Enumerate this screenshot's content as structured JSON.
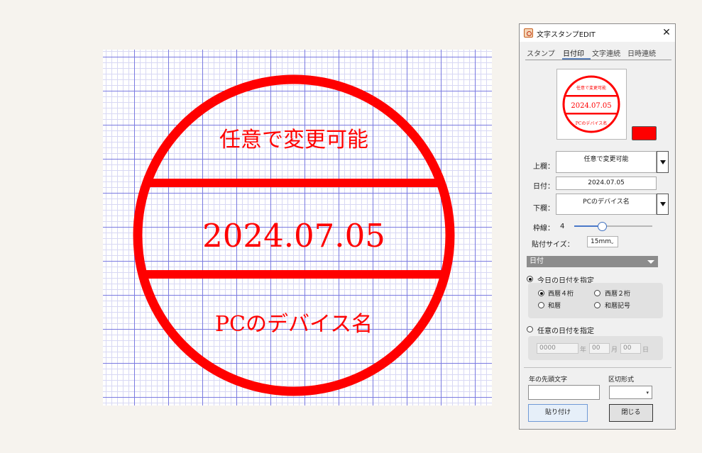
{
  "canvas": {
    "stamp": {
      "top_text": "任意で変更可能",
      "date_text": "2024.07.05",
      "bottom_text": "PCのデバイス名",
      "color": "#ff0000"
    }
  },
  "dialog": {
    "title": "文字スタンプEDIT",
    "close_glyph": "✕",
    "tabs": [
      "スタンプ",
      "日付印",
      "文字連続",
      "日時連続"
    ],
    "active_tab": "日付印",
    "preview": {
      "top_text": "任意で変更可能",
      "date_text": "2024.07.05",
      "bottom_text": "PCのデバイス名"
    },
    "stamp_color": "#ff0000",
    "upper_label": "上欄：",
    "upper_value": "任意で変更可能",
    "date_label": "日付：",
    "date_value": "2024.07.05",
    "lower_label": "下欄：",
    "lower_value": "PCのデバイス名",
    "border_label": "枠線：",
    "border_value": "4",
    "size_label": "貼付サイズ：",
    "size_value": "15mm",
    "section_title": "日付",
    "today_option": "今日の日付を指定",
    "format_options": [
      "西暦４桁",
      "西暦２桁",
      "和暦",
      "和暦記号"
    ],
    "selected_format": "西暦４桁",
    "custom_option": "任意の日付を指定",
    "custom_date": {
      "year": "0000",
      "year_unit": "年",
      "month": "00",
      "month_unit": "月",
      "day": "00",
      "day_unit": "日"
    },
    "prefix_label": "年の先頭文字",
    "separator_label": "区切形式",
    "paste_button": "貼り付け",
    "close_button": "閉じる"
  }
}
